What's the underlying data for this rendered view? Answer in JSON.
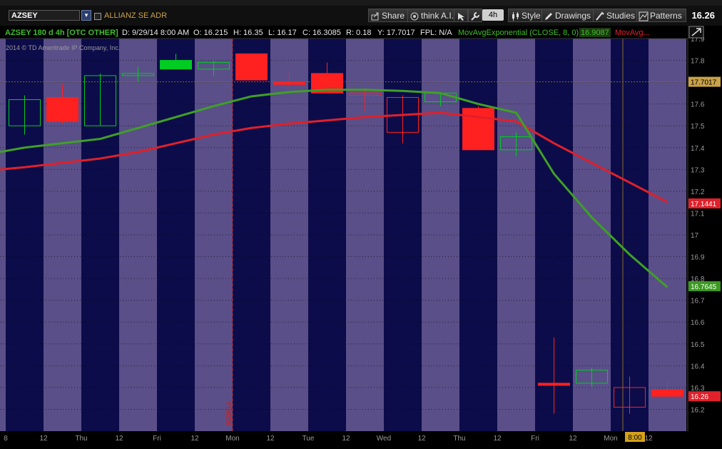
{
  "toolbar": {
    "symbol": "AZSEY",
    "description": "ALLIANZ SE ADR",
    "buttons": {
      "share": "Share",
      "think_ai": "think A.I.",
      "aggregation": "4h",
      "style": "Style",
      "drawings": "Drawings",
      "studies": "Studies",
      "patterns": "Patterns"
    },
    "last_price": "16.26"
  },
  "header": {
    "title": "AZSEY 180 d 4h [OTC OTHER]",
    "date": "D: 9/29/14 8:00 AM",
    "open": "O: 16.215",
    "high": "H: 16.35",
    "low": "L: 16.17",
    "close": "C: 16.3085",
    "range": "R: 0.18",
    "y": "Y: 17.7017",
    "fpl": "FPL: N/A",
    "study1": "MovAvgExponential (CLOSE, 8, 0)",
    "study1_value": "16.9087",
    "study2": "MovAvg..."
  },
  "copyright": "2014 © TD Ameritrade IP Company, Inc.",
  "vline_label": "9/29/14",
  "price_labels": {
    "crosshair": "17.7017",
    "red_ma": "17.1441",
    "green_ma": "16.7645",
    "last": "16.26"
  },
  "time_badge": "8:00",
  "colors": {
    "up": "#00cc22",
    "down": "#ff2020",
    "ema": "#3fa026",
    "sma": "#e0202a",
    "band_dark": "#0c0c4a",
    "band_light": "#5a4f88"
  },
  "chart_data": {
    "type": "candlestick",
    "ylim": [
      16.1,
      17.9
    ],
    "y_ticks": [
      16.2,
      16.3,
      16.4,
      16.5,
      16.6,
      16.7,
      16.8,
      16.9,
      17,
      17.1,
      17.2,
      17.3,
      17.4,
      17.5,
      17.6,
      17.7,
      17.8,
      17.9
    ],
    "y_tick_labels": [
      "16.2",
      "16.3",
      "16.4",
      "16.5",
      "16.6",
      "16.7",
      "16.8",
      "16.9",
      "17",
      "17.1",
      "17.2",
      "17.3",
      "17.4",
      "17.5",
      "17.6",
      "17.7",
      "17.8",
      "17.9"
    ],
    "x_labels": [
      "8",
      "12",
      "Thu",
      "12",
      "Fri",
      "12",
      "Mon",
      "12",
      "Tue",
      "12",
      "Wed",
      "12",
      "Thu",
      "12",
      "Fri",
      "12",
      "Mon",
      "12"
    ],
    "candles": [
      {
        "open": 17.5,
        "high": 17.64,
        "low": 17.46,
        "close": 17.62
      },
      {
        "open": 17.63,
        "high": 17.69,
        "low": 17.51,
        "close": 17.52
      },
      {
        "open": 17.5,
        "high": 17.74,
        "low": 17.5,
        "close": 17.73
      },
      {
        "open": 17.74,
        "high": 17.77,
        "low": 17.7,
        "close": 17.74
      },
      {
        "open": 17.76,
        "high": 17.83,
        "low": 17.76,
        "close": 17.8
      },
      {
        "open": 17.76,
        "high": 17.8,
        "low": 17.73,
        "close": 17.79
      },
      {
        "open": 17.83,
        "high": 17.83,
        "low": 17.71,
        "close": 17.71
      },
      {
        "open": 17.7,
        "high": 17.75,
        "low": 17.67,
        "close": 17.69
      },
      {
        "open": 17.74,
        "high": 17.79,
        "low": 17.65,
        "close": 17.65
      },
      {
        "open": 17.65,
        "high": 17.67,
        "low": 17.57,
        "close": 17.64
      },
      {
        "open": 17.63,
        "high": 17.64,
        "low": 17.42,
        "close": 17.47
      },
      {
        "open": 17.61,
        "high": 17.65,
        "low": 17.59,
        "close": 17.65
      },
      {
        "open": 17.58,
        "high": 17.59,
        "low": 17.39,
        "close": 17.39
      },
      {
        "open": 17.39,
        "high": 17.47,
        "low": 17.36,
        "close": 17.45
      },
      {
        "open": 16.32,
        "high": 16.53,
        "low": 16.18,
        "close": 16.31
      },
      {
        "open": 16.32,
        "high": 16.39,
        "low": 16.3,
        "close": 16.38
      },
      {
        "open": 16.3,
        "high": 16.35,
        "low": 16.18,
        "close": 16.21
      },
      {
        "open": 16.29,
        "high": 16.33,
        "low": 16.25,
        "close": 16.26
      }
    ],
    "series": [
      {
        "name": "MovAvgExponential (CLOSE, 8, 0)",
        "values": [
          17.4,
          17.42,
          17.44,
          17.49,
          17.54,
          17.59,
          17.635,
          17.655,
          17.665,
          17.665,
          17.66,
          17.65,
          17.6,
          17.56,
          17.28,
          17.08,
          16.91,
          16.76
        ]
      },
      {
        "name": "MovAvg...",
        "values": [
          17.31,
          17.33,
          17.35,
          17.38,
          17.42,
          17.46,
          17.49,
          17.51,
          17.525,
          17.54,
          17.55,
          17.56,
          17.54,
          17.52,
          17.42,
          17.33,
          17.24,
          17.15
        ]
      }
    ],
    "crosshair_value": 17.7017,
    "time_marker_value": "9/29/14"
  }
}
